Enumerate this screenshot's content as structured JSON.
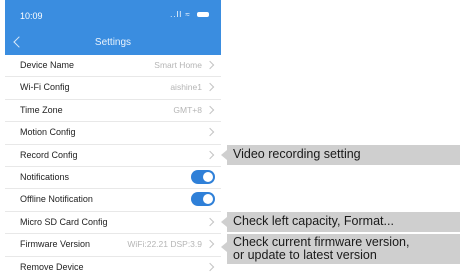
{
  "status_bar": {
    "time": "10:09",
    "signal_text": "..ll",
    "wifi_glyph": "≈",
    "icons": [
      "signal-icon",
      "wifi-icon",
      "battery-icon"
    ]
  },
  "nav": {
    "title": "Settings",
    "back_icon": "chevron-left-icon"
  },
  "rows": [
    {
      "label": "Device Name",
      "value": "Smart Home",
      "control": "chevron"
    },
    {
      "label": "Wi-Fi Config",
      "value": "aishine1",
      "control": "chevron"
    },
    {
      "label": "Time Zone",
      "value": "GMT+8",
      "control": "chevron"
    },
    {
      "label": "Motion Config",
      "value": "",
      "control": "chevron"
    },
    {
      "label": "Record Config",
      "value": "",
      "control": "chevron"
    },
    {
      "label": "Notifications",
      "value": "",
      "control": "toggle",
      "toggle_on": true
    },
    {
      "label": "Offline Notification",
      "value": "",
      "control": "toggle",
      "toggle_on": true
    },
    {
      "label": "Micro SD Card Config",
      "value": "",
      "control": "chevron"
    },
    {
      "label": "Firmware Version",
      "value": "WiFi:22.21 DSP:3.9",
      "control": "chevron"
    },
    {
      "label": "Remove Device",
      "value": "",
      "control": "chevron"
    }
  ],
  "annotations": {
    "record": "Video recording setting",
    "sdcard": "Check left capacity, Format...",
    "firmware_line1": "Check current firmware version,",
    "firmware_line2": "or update to latest version"
  },
  "colors": {
    "header_blue": "#3a8de0",
    "toggle_blue": "#2f80d8",
    "annotation_gray": "#cfcfcf"
  }
}
